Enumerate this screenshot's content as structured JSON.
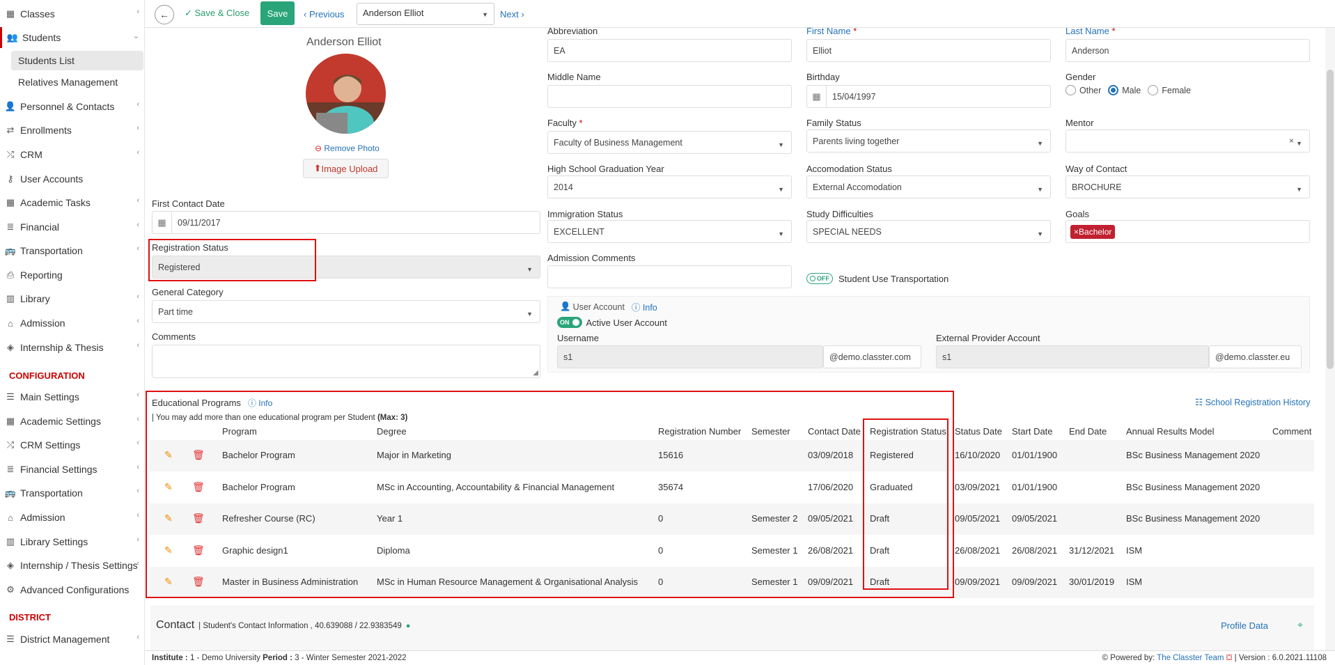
{
  "sidebar": {
    "items": [
      {
        "label": "Classes",
        "icon": "classes-icon"
      },
      {
        "label": "Students",
        "icon": "students-icon"
      },
      {
        "label": "Personnel & Contacts",
        "icon": "personnel-icon"
      },
      {
        "label": "Enrollments",
        "icon": "enrollments-icon"
      },
      {
        "label": "CRM",
        "icon": "crm-icon"
      },
      {
        "label": "User Accounts",
        "icon": "key-icon"
      },
      {
        "label": "Academic Tasks",
        "icon": "tasks-icon"
      },
      {
        "label": "Financial",
        "icon": "financial-icon"
      },
      {
        "label": "Transportation",
        "icon": "bus-icon"
      },
      {
        "label": "Reporting",
        "icon": "printer-icon"
      },
      {
        "label": "Library",
        "icon": "library-icon"
      },
      {
        "label": "Admission",
        "icon": "building-icon"
      },
      {
        "label": "Internship & Thesis",
        "icon": "cube-icon"
      }
    ],
    "sub_items": [
      {
        "label": "Students List"
      },
      {
        "label": "Relatives Management"
      }
    ],
    "config_title": "CONFIGURATION",
    "config_items": [
      {
        "label": "Main Settings"
      },
      {
        "label": "Academic Settings"
      },
      {
        "label": "CRM Settings"
      },
      {
        "label": "Financial Settings"
      },
      {
        "label": "Transportation"
      },
      {
        "label": "Admission"
      },
      {
        "label": "Library Settings"
      },
      {
        "label": "Internship / Thesis Settings"
      },
      {
        "label": "Advanced Configurations"
      }
    ],
    "district_title": "DISTRICT",
    "district_items": [
      {
        "label": "District Management"
      }
    ]
  },
  "toolbar": {
    "save_close": "Save & Close",
    "save": "Save",
    "previous": "Previous",
    "student_select": "Anderson Elliot",
    "next": "Next"
  },
  "profile": {
    "name": "Anderson Elliot",
    "remove_photo": "Remove Photo",
    "image_upload": "Image Upload"
  },
  "form": {
    "first_contact_label": "First Contact Date",
    "first_contact_value": "09/11/2017",
    "reg_status_label": "Registration Status",
    "reg_status_value": "Registered",
    "general_category_label": "General Category",
    "general_category_value": "Part time",
    "comments_label": "Comments",
    "abbreviation_label": "Abbreviation",
    "abbreviation_value": "EA",
    "first_name_label": "First Name",
    "first_name_value": "Elliot",
    "last_name_label": "Last Name",
    "last_name_value": "Anderson",
    "middle_name_label": "Middle Name",
    "birthday_label": "Birthday",
    "birthday_value": "15/04/1997",
    "gender_label": "Gender",
    "gender_options": [
      "Other",
      "Male",
      "Female"
    ],
    "gender_selected": "Male",
    "faculty_label": "Faculty",
    "faculty_value": "Faculty of Business Management",
    "family_status_label": "Family Status",
    "family_status_value": "Parents living together",
    "mentor_label": "Mentor",
    "hs_grad_label": "High School Graduation Year",
    "hs_grad_value": "2014",
    "accomodation_label": "Accomodation Status",
    "accomodation_value": "External Accomodation",
    "way_contact_label": "Way of Contact",
    "way_contact_value": "BROCHURE",
    "immigration_label": "Immigration Status",
    "immigration_value": "EXCELLENT",
    "study_diff_label": "Study Difficulties",
    "study_diff_value": "SPECIAL NEEDS",
    "goals_label": "Goals",
    "goals_tag": "Bachelor",
    "admission_comments_label": "Admission Comments",
    "transport_toggle": "OFF",
    "transport_label": "Student Use Transportation",
    "user_account_label": "User Account",
    "info_label": "Info",
    "active_toggle": "ON",
    "active_label": "Active User Account",
    "username_label": "Username",
    "username_value": "s1",
    "username_domain": "@demo.classter.com",
    "ext_provider_label": "External Provider Account",
    "ext_provider_value": "s1",
    "ext_provider_domain": "@demo.classter.eu"
  },
  "programs": {
    "title": "Educational Programs",
    "info": "Info",
    "history_link": "School Registration History",
    "note": "| You may add more than one educational program per Student",
    "note_max": "(Max: 3)",
    "columns": [
      "Program",
      "Degree",
      "Registration Number",
      "Semester",
      "Contact Date",
      "Registration Status",
      "Status Date",
      "Start Date",
      "End Date",
      "Annual Results Model",
      "Comment"
    ],
    "rows": [
      [
        "Bachelor Program",
        "Major in Marketing",
        "15616",
        "",
        "03/09/2018",
        "Registered",
        "16/10/2020",
        "01/01/1900",
        "",
        "BSc Business Management 2020",
        ""
      ],
      [
        "Bachelor Program",
        "MSc in Accounting, Accountability & Financial Management",
        "35674",
        "",
        "17/06/2020",
        "Graduated",
        "03/09/2021",
        "01/01/1900",
        "",
        "BSc Business Management 2020",
        ""
      ],
      [
        "Refresher Course (RC)",
        "Year 1",
        "0",
        "Semester 2",
        "09/05/2021",
        "Draft",
        "09/05/2021",
        "09/05/2021",
        "",
        "BSc Business Management 2020",
        ""
      ],
      [
        "Graphic design1",
        "Diploma",
        "0",
        "Semester 1",
        "26/08/2021",
        "Draft",
        "26/08/2021",
        "26/08/2021",
        "31/12/2021",
        "ISM",
        ""
      ],
      [
        "Master in Business Administration",
        "MSc in Human Resource Management & Organisational Analysis",
        "0",
        "Semester 1",
        "09/09/2021",
        "Draft",
        "09/09/2021",
        "09/09/2021",
        "30/01/2019",
        "ISM",
        ""
      ]
    ]
  },
  "contact": {
    "title": "Contact",
    "subtitle": "| Student's Contact Information , 40.639088 / 22.9383549",
    "profile_data": "Profile Data"
  },
  "footer": {
    "institute_label": "Institute :",
    "institute_value": "1 - Demo University",
    "period_label": "Period :",
    "period_value": "3 - Winter Semester 2021-2022",
    "powered_by": "Powered by:",
    "powered_link": "The Classter Team",
    "version": "| Version : 6.0.2021.11108"
  },
  "colors": {
    "accent_green": "#2aa57a",
    "link_blue": "#2472b8",
    "highlight_red": "#e01010",
    "config_red": "#cc0000"
  }
}
